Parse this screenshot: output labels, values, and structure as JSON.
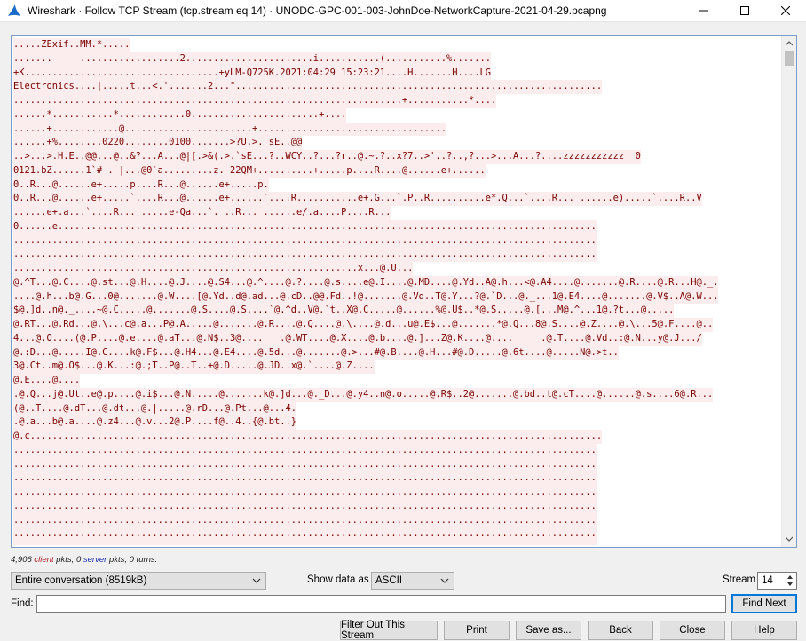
{
  "window": {
    "title": "Wireshark · Follow TCP Stream (tcp.stream eq 14) · UNODC-GPC-001-003-JohnDoe-NetworkCapture-2021-04-29.pcapng"
  },
  "stream": {
    "lines": [
      ".....ZExif..MM.*.....",
      ".......     ..................2.......................i...........(...........%.......",
      "+K...................................+yLM-Q725K.2021:04:29 15:23:21....H.......H....LG",
      "Electronics....|.....t...<.'.......2...\"..................................................................",
      "......................................................................+...........*....",
      "......*...........*............0.......................+....",
      "......+............@.......................+..................................",
      "......+%........0220........0100.......>?U.>. sE..@@",
      "..>...>.H.E..@@...@..&?...A...@|[.>&(.>.`sE...?..WCY..?...?r..@.~.?..x?7..>'..?..,?...>...A...?....zzzzzzzzzzz  0",
      "0121.bZ......1`# . |...@0`a.........z. 22QM+..........+.....p....R....@......e+......",
      "0..R...@......e+.....p....R...@......e+.....p.",
      "0..R...@......e+.....`....R...@......e+......`....R...........e+.G...`.P..R..........e*.Q...`....R... ......e).....`....R..V",
      "......e+.a...`....R... .....e-Qa...`. ..R... ......e/.a....P....R...",
      "0......e.................................................................................................",
      ".........................................................................................................",
      ".........................................................................................................",
      "..............................................................x...@.U...",
      "@.^T...@.C....@.st...@.H....@.J....@.S4...@.^....@.?....@.s....e@.I....@.MD....@.Yd..A@.h...<@.A4....@.......@.R....@.R...H@._.",
      "....@.h...b@.G...0@.......@.W....[@.Yd..d@.ad...@.cD..@@.Fd..!@.......@.Vd..T@.Y...?@.`D...@._...1@.E4....@.......@.V$..A@.W...",
      "$@.]d..n@._....~@.C.....@.......@.S....@.S....`@.^d..V@.`t..X@.C.....@......%@.U$..*@.S.....@.[...M@.^...1@.?t...@.....",
      "@.RT...@.Rd...@.\\...c@.a...P@.A.....@.......@.R....@.Q....@.\\....@.d...u@.E$...@.......*@.Q...8@.S....@.Z....@.\\...5@.F....@..",
      "4...@.O....(@.P....@.e....@.aT...@.N$..3@....   .@.WT....@.X....@.b....@.]...Z@.K....@....     .@.T....@.Vd..:@.N...y@.J.../",
      "@.:D...@.....I@.C....k@.F$...@.H4...@.E4....@.5d...@.......@.>...#@.B....@.H...#@.D.....@.6t....@.....N@.>t..",
      "3@.Ct..m@.O$...@.K...:@.;T..P@..T..+@.D.....@.JD..x@.`....@.Z....",
      "@.E....@....",
      ".@.Q...j@.Ut..e@.p....@.i$...@.N.....@.......k@.]d...@._D...@.y4..n@.o.....@.R$..2@.......@.bd..t@.cT....@......@.s....6@.R...",
      "(@..T....@.dT...@.dt...@.|.....@.rD...@.Pt...@...4.",
      ".@.a...b@.a....@.z4...@.v...2@.P....f@..4..{@.bt..}",
      "@.c.......................................................................................................",
      ".........................................................................................................",
      ".........................................................................................................",
      ".........................................................................................................",
      ".........................................................................................................",
      ".........................................................................................................",
      ".........................................................................................................",
      ".........................................................................................................",
      ".........................................................................................................",
      "........................................................................................................."
    ]
  },
  "stats": {
    "client_count": "4,906",
    "client_label": "client",
    "mid1": "pkts,",
    "server_count": "0",
    "server_label": "server",
    "mid2": "pkts, 0 turns."
  },
  "controls": {
    "conversation_value": "Entire conversation (8519kB)",
    "show_data_label": "Show data as",
    "show_data_value": "ASCII",
    "stream_label": "Stream",
    "stream_value": "14",
    "find_label": "Find:",
    "find_value": ""
  },
  "buttons": {
    "find_next": "Find Next",
    "filter_out": "Filter Out This Stream",
    "print": "Print",
    "save_as": "Save as...",
    "back": "Back",
    "close": "Close",
    "help": "Help"
  },
  "colors": {
    "client_text": "#7a0000",
    "client_bg": "#fbeded",
    "accent": "#0078d7"
  }
}
